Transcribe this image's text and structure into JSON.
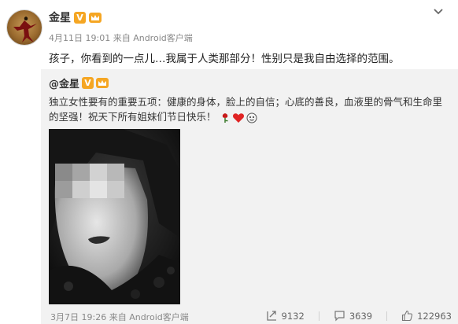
{
  "post": {
    "author": "金星",
    "time": "4月11日 19:01",
    "via": "来自",
    "source": "Android客户端",
    "text": "孩子，你看到的一点儿…我属于人类那部分！性别只是我自由选择的范围。"
  },
  "repost": {
    "author": "@金星",
    "text": "独立女性要有的重要五项：健康的身体，脸上的自信；心底的善良，血液里的骨气和生命里的坚强！祝天下所有姐妹们节日快乐！",
    "time": "3月7日 19:26",
    "via": "来自",
    "source": "Android客户端",
    "reposts": "9132",
    "comments": "3639",
    "likes": "122963"
  },
  "icons": {
    "verified": "vip-v-icon",
    "member": "crown-icon",
    "menu": "chevron-down-icon",
    "repost": "repost-icon",
    "comment": "comment-icon",
    "like": "thumbs-up-icon",
    "emoji_rose": "rose-emoji",
    "emoji_heart": "heart-emoji",
    "emoji_face": "face-emoji"
  },
  "colors": {
    "badge_orange": "#f5a623",
    "repost_bg": "#f2f2f2",
    "meta_gray": "#888888"
  }
}
